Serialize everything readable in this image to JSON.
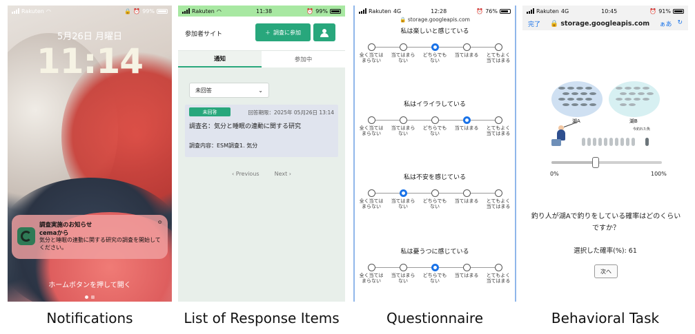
{
  "colors": {
    "accent_green": "#28a77c",
    "radio_blue": "#1a73e8",
    "status_green": "#a8e8a2"
  },
  "captions": [
    "Notifications",
    "List of Response Items",
    "Questionnaire",
    "Behavioral Task"
  ],
  "p1": {
    "carrier": "Rakuten",
    "battery": "99%",
    "date": "5月26日 月曜日",
    "time": "11:14",
    "notification": {
      "title": "調査実施のお知らせ",
      "from": "cemaから",
      "body": "気分と睡眠の連動に関する研究の調査を開始してください。"
    },
    "home_hint": "ホームボタンを押して開く"
  },
  "p2": {
    "carrier": "Rakuten",
    "time": "11:38",
    "battery": "99%",
    "site_label": "参加者サイト",
    "join_label": "調査に参加",
    "tabs": [
      "通知",
      "参加中"
    ],
    "filter": "未回答",
    "card": {
      "badge": "未回答",
      "deadline": "回答期限：2025年 05月26日 13:14",
      "survey_name": "調査名：気分と睡眠の連動に関する研究",
      "survey_content": "調査内容：ESM調査1. 気分"
    },
    "pager": {
      "prev": "‹  Previous",
      "next": "Next  ›"
    }
  },
  "p3": {
    "carrier": "Rakuten",
    "network": "4G",
    "time": "12:28",
    "battery": "76%",
    "url": "🔒 storage.googleapis.com",
    "scale_labels": [
      [
        "全く当ては",
        "まらない"
      ],
      [
        "当てはまら",
        "ない"
      ],
      [
        "どちらでも",
        "ない"
      ],
      [
        "当てはまる",
        ""
      ],
      [
        "とてもよく",
        "当てはまる"
      ]
    ],
    "questions": [
      {
        "text": "私は楽しいと感じている",
        "selected": 3
      },
      {
        "text": "私はイライラしている",
        "selected": 4
      },
      {
        "text": "私は不安を感じている",
        "selected": 2
      },
      {
        "text": "私は憂うつに感じている",
        "selected": 3
      }
    ]
  },
  "p4": {
    "carrier": "Rakuten",
    "network": "4G",
    "time": "10:45",
    "battery": "91%",
    "done": "完了",
    "host": "🔒 storage.googleapis.com",
    "text_size": "ぁあ",
    "lake_a": "湖A",
    "lake_b": "湖B",
    "caught_label": "今釣れた魚",
    "slider_value_percent": 40,
    "min_label": "0%",
    "max_label": "100%",
    "question": "釣り人が湖Aで釣りをしている確率はどのくらいですか？",
    "selected_label": "選択した確率(%): 61",
    "next": "次へ"
  }
}
